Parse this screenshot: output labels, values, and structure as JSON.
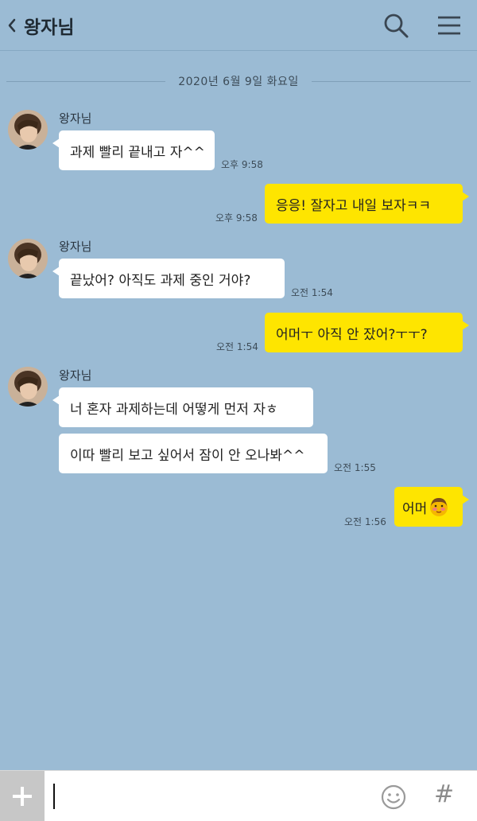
{
  "header": {
    "title": "왕자님",
    "back_icon": "chevron-left-icon",
    "search_icon": "search-icon",
    "menu_icon": "hamburger-menu-icon"
  },
  "date_separator": "2020년 6월 9일 화요일",
  "messages": [
    {
      "sender": "왕자님",
      "text": "과제 빨리 끝내고 자^^",
      "time": "오후 9:58",
      "side": "in"
    },
    {
      "text": "응응! 잘자고 내일 보자ㅋㅋ",
      "time": "오후 9:58",
      "side": "out"
    },
    {
      "sender": "왕자님",
      "text": "끝났어? 아직도 과제 중인 거야?",
      "time": "오전 1:54",
      "side": "in"
    },
    {
      "text": "어머ㅜ 아직 안 잤어?ㅜㅜ?",
      "time": "오전 1:54",
      "side": "out"
    },
    {
      "sender": "왕자님",
      "text": "너 혼자 과제하는데 어떻게 먼저 자ㅎ",
      "side": "in"
    },
    {
      "text": "이따 빨리 보고 싶어서 잠이 안 오나봐^^",
      "time": "오전 1:55",
      "side": "in"
    },
    {
      "text": "어머",
      "emoji": "blushing-face-icon",
      "time": "오전 1:56",
      "side": "out"
    }
  ],
  "input": {
    "plus_icon": "plus-icon",
    "emoji_icon": "smiley-icon",
    "hash_label": "#"
  },
  "colors": {
    "background": "#9bbbd4",
    "outgoing_bubble": "#fee500",
    "incoming_bubble": "#ffffff"
  }
}
